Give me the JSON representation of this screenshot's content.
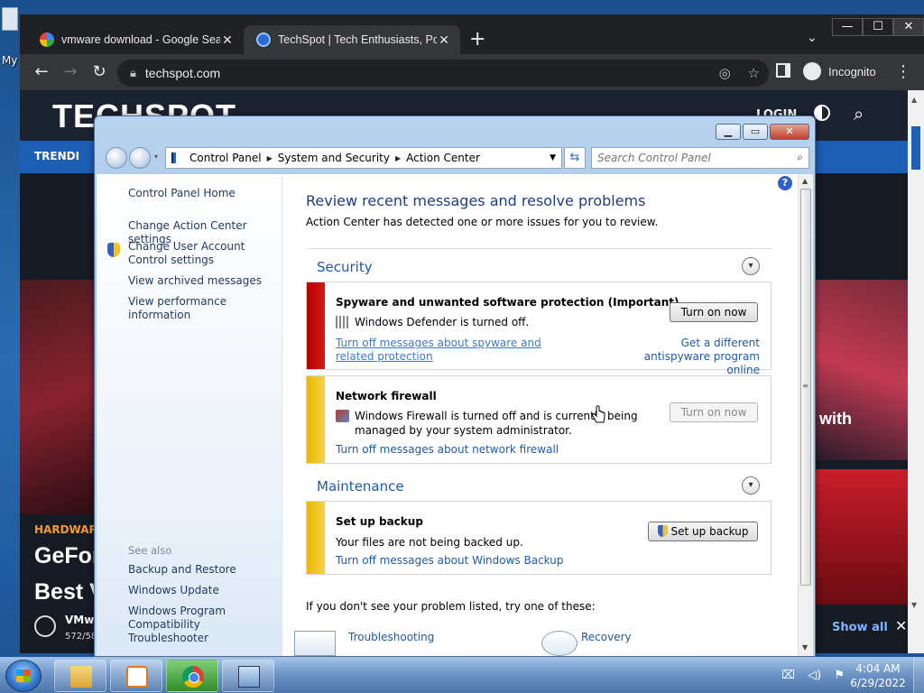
{
  "desktop": {
    "icon_label": "My"
  },
  "browser": {
    "tabs": [
      {
        "title": "vmware download - Google Sear",
        "close": "✕"
      },
      {
        "title": "TechSpot | Tech Enthusiasts, Pow",
        "close": "✕"
      }
    ],
    "new_tab": "+",
    "address": "techspot.com",
    "profile_label": "Incognito",
    "window_buttons": {
      "minimize": "—",
      "maximize": "☐",
      "close": "✕"
    }
  },
  "techspot": {
    "logo": "TECHSPOT",
    "login": "LOGIN",
    "nav_trending": "TRENDI",
    "right_promo_text": "with",
    "hardware_tag": "HARDWARE",
    "headline_1": "GeFor",
    "headline_2": "Best V",
    "download_title": "VMw",
    "download_count": "572/58",
    "show_all": "Show all",
    "close_bar": "✕"
  },
  "action_center": {
    "breadcrumb": [
      "Control Panel",
      "System and Security",
      "Action Center"
    ],
    "search_placeholder": "Search Control Panel",
    "left_pane": {
      "home": "Control Panel Home",
      "links": [
        "Change Action Center settings",
        "Change User Account Control settings",
        "View archived messages",
        "View performance information"
      ],
      "see_also_title": "See also",
      "see_also": [
        "Backup and Restore",
        "Windows Update",
        "Windows Program Compatibility Troubleshooter"
      ]
    },
    "main": {
      "title": "Review recent messages and resolve problems",
      "subtitle": "Action Center has detected one or more issues for you to review.",
      "security_title": "Security",
      "maintenance_title": "Maintenance",
      "cards": {
        "spyware": {
          "title": "Spyware and unwanted software protection  (Important)",
          "desc": "Windows Defender is turned off.",
          "link_left": "Turn off messages about spyware and related protection",
          "link_right": "Get a different antispyware program online",
          "button": "Turn on now",
          "color": "#c40000"
        },
        "firewall": {
          "title": "Network firewall",
          "desc": "Windows Firewall is turned off and is currently being managed by your system administrator.",
          "link": "Turn off messages about network firewall",
          "button": "Turn on now",
          "color": "#f0c419"
        },
        "backup": {
          "title": "Set up backup",
          "desc": "Your files are not being backed up.",
          "link": "Turn off messages about Windows Backup",
          "button": "Set up backup",
          "color": "#f0c419"
        }
      },
      "footer_question": "If you don't see your problem listed, try one of these:",
      "footer_items": [
        "Troubleshooting",
        "Recovery"
      ]
    }
  },
  "taskbar": {
    "time": "4:04 AM",
    "date": "6/29/2022"
  }
}
